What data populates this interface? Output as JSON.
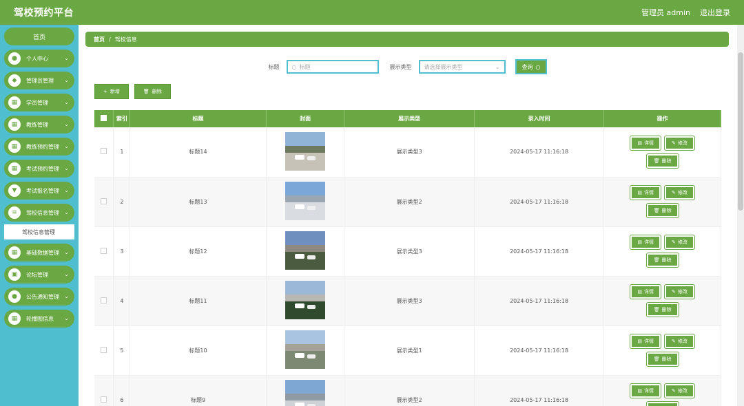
{
  "app": {
    "title": "驾校预约平台",
    "user": "管理员 admin",
    "logout": "退出登录"
  },
  "sidebar": {
    "home": "首页",
    "items": [
      {
        "label": "个人中心",
        "icon": "person-icon"
      },
      {
        "label": "管理员管理",
        "icon": "shield-icon"
      },
      {
        "label": "学员管理",
        "icon": "grid-icon"
      },
      {
        "label": "教练管理",
        "icon": "grid-icon"
      },
      {
        "label": "教练预约管理",
        "icon": "grid-icon"
      },
      {
        "label": "考试预约管理",
        "icon": "grid-icon"
      },
      {
        "label": "考试报名管理",
        "icon": "cup-icon"
      },
      {
        "label": "驾校信息管理",
        "icon": "list-icon",
        "sub": "驾校信息管理"
      },
      {
        "label": "基础数据管理",
        "icon": "grid-icon"
      },
      {
        "label": "论坛管理",
        "icon": "bag-icon"
      },
      {
        "label": "公告通知管理",
        "icon": "person-icon"
      },
      {
        "label": "轮播图信息",
        "icon": "grid-icon"
      }
    ]
  },
  "breadcrumb": {
    "home": "首页",
    "sep": "/",
    "current": "驾校信息"
  },
  "search": {
    "title_label": "标题",
    "title_placeholder": "标题",
    "type_label": "展示类型",
    "type_placeholder": "请选择展示类型",
    "button": "查询"
  },
  "actions": {
    "add": "新增",
    "delete": "删除"
  },
  "table": {
    "headers": [
      "索引",
      "标题",
      "封面",
      "展示类型",
      "录入时间",
      "操作"
    ],
    "ops": {
      "detail": "详情",
      "edit": "修改",
      "delete": "删除"
    },
    "rows": [
      {
        "index": "1",
        "title": "标题14",
        "type": "展示类型3",
        "time": "2024-05-17 11:16:18"
      },
      {
        "index": "2",
        "title": "标题13",
        "type": "展示类型2",
        "time": "2024-05-17 11:16:18"
      },
      {
        "index": "3",
        "title": "标题12",
        "type": "展示类型3",
        "time": "2024-05-17 11:16:18"
      },
      {
        "index": "4",
        "title": "标题11",
        "type": "展示类型3",
        "time": "2024-05-17 11:16:18"
      },
      {
        "index": "5",
        "title": "标题10",
        "type": "展示类型1",
        "time": "2024-05-17 11:16:18"
      },
      {
        "index": "6",
        "title": "标题9",
        "type": "展示类型2",
        "time": "2024-05-17 11:16:18"
      }
    ]
  },
  "colors": {
    "green": "#6aa843",
    "teal": "#4fbfcf"
  }
}
